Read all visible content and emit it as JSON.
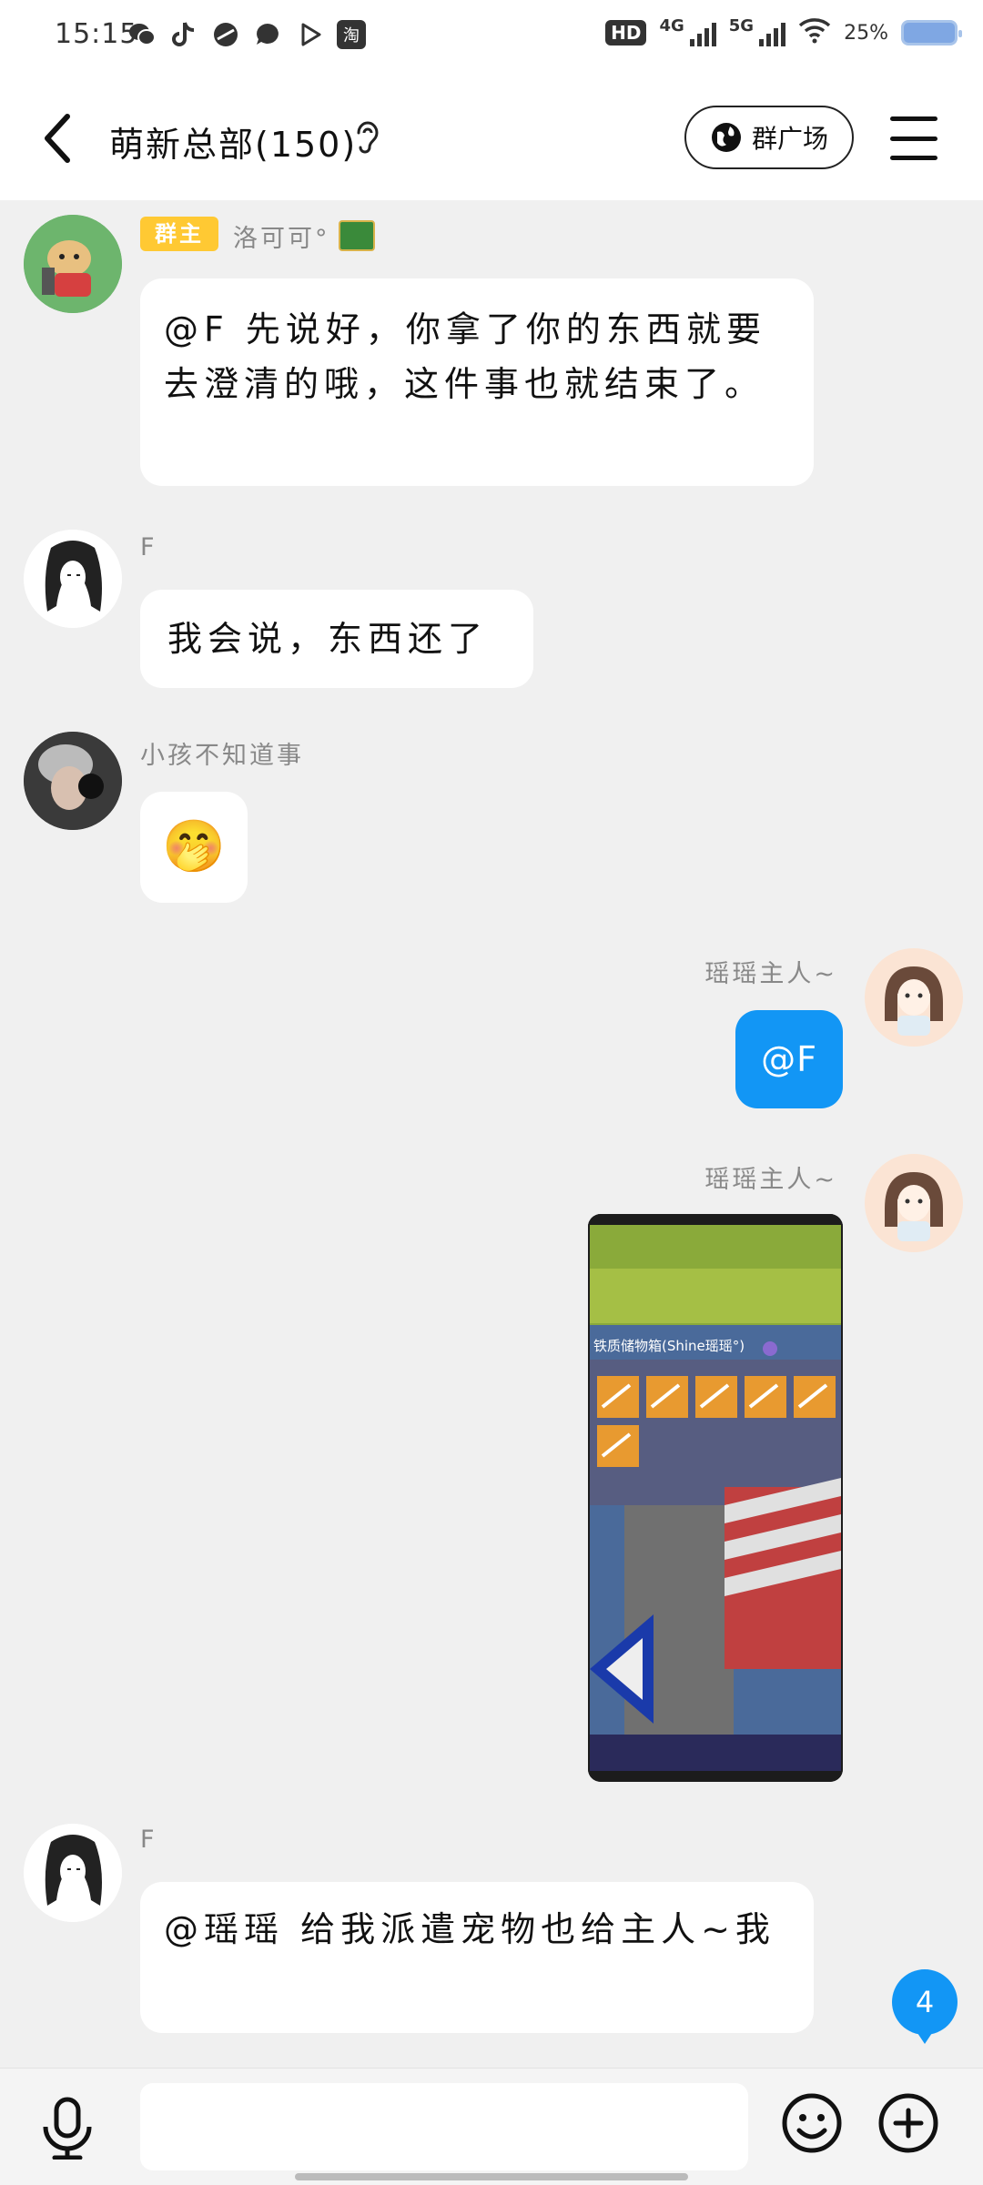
{
  "status_bar": {
    "time": "15:15",
    "app_icons": [
      "wechat-icon",
      "tiktok-icon",
      "shard-icon",
      "chat-icon",
      "play-icon",
      "taobao-icon"
    ],
    "taobao_label": "淘",
    "hd_label": "HD",
    "network_1": "4G",
    "network_2": "5G",
    "battery": "25%"
  },
  "header": {
    "title": "萌新总部(150)",
    "plaza_label": "群广场"
  },
  "messages": [
    {
      "sender": "洛可可°",
      "role_badge": "群主",
      "text": "@F 先说好，你拿了你的东西就要去澄清的哦，这件事也就结束了。"
    },
    {
      "sender": "F",
      "text": "我会说，东西还了"
    },
    {
      "sender": "小孩不知道事",
      "emoji": "🤭"
    },
    {
      "sender": "瑶瑶主人~",
      "text": "@F"
    },
    {
      "sender": "瑶瑶主人~",
      "image_caption": "铁质储物箱(Shine瑶瑶°)"
    },
    {
      "sender": "F",
      "text": "@瑶瑶 给我派遣宠物也给主人~我"
    }
  ],
  "unread_count": "4",
  "input": {
    "placeholder": ""
  },
  "colors": {
    "accent": "#1296f5",
    "badge": "#ffc933",
    "background": "#f0f0f0"
  }
}
